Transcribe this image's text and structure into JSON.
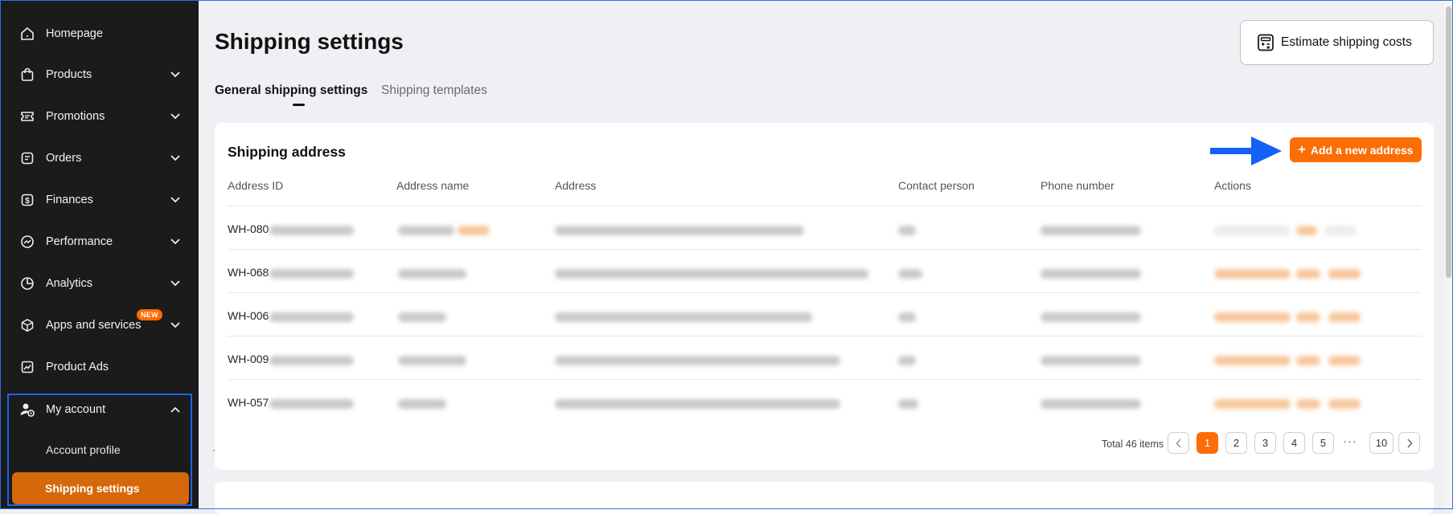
{
  "sidebar": {
    "items": [
      {
        "label": "Homepage",
        "icon": "home-icon"
      },
      {
        "label": "Products",
        "icon": "bag-icon"
      },
      {
        "label": "Promotions",
        "icon": "ticket-icon"
      },
      {
        "label": "Orders",
        "icon": "order-icon"
      },
      {
        "label": "Finances",
        "icon": "dollar-icon"
      },
      {
        "label": "Performance",
        "icon": "trend-icon"
      },
      {
        "label": "Analytics",
        "icon": "pie-icon"
      },
      {
        "label": "Apps and services",
        "icon": "cube-icon",
        "badge": "NEW"
      },
      {
        "label": "Product Ads",
        "icon": "chart-icon"
      }
    ],
    "my_account": {
      "label": "My account",
      "icon": "user-gear-icon",
      "sub_items": [
        "Account profile",
        "Shipping settings"
      ]
    }
  },
  "page": {
    "title": "Shipping settings",
    "estimate_button": "Estimate shipping costs",
    "tabs": [
      "General shipping settings",
      "Shipping templates"
    ]
  },
  "shipping_address": {
    "title": "Shipping address",
    "add_button": "Add a new address",
    "columns": [
      "Address ID",
      "Address name",
      "Address",
      "Contact person",
      "Phone number",
      "Actions"
    ],
    "rows": [
      {
        "id_prefix": "WH-080"
      },
      {
        "id_prefix": "WH-068"
      },
      {
        "id_prefix": "WH-006"
      },
      {
        "id_prefix": "WH-009"
      },
      {
        "id_prefix": "WH-057"
      }
    ]
  },
  "pagination": {
    "total": "Total 46 items",
    "pages": [
      "1",
      "2",
      "3",
      "4",
      "5",
      "10"
    ],
    "ellipsis": "···",
    "current": "1"
  },
  "colors": {
    "accent": "#fb6e06",
    "sidebar_bg": "#1b1b1b",
    "highlight_box": "#1f63e8",
    "annotation_arrow": "#1560f5"
  }
}
